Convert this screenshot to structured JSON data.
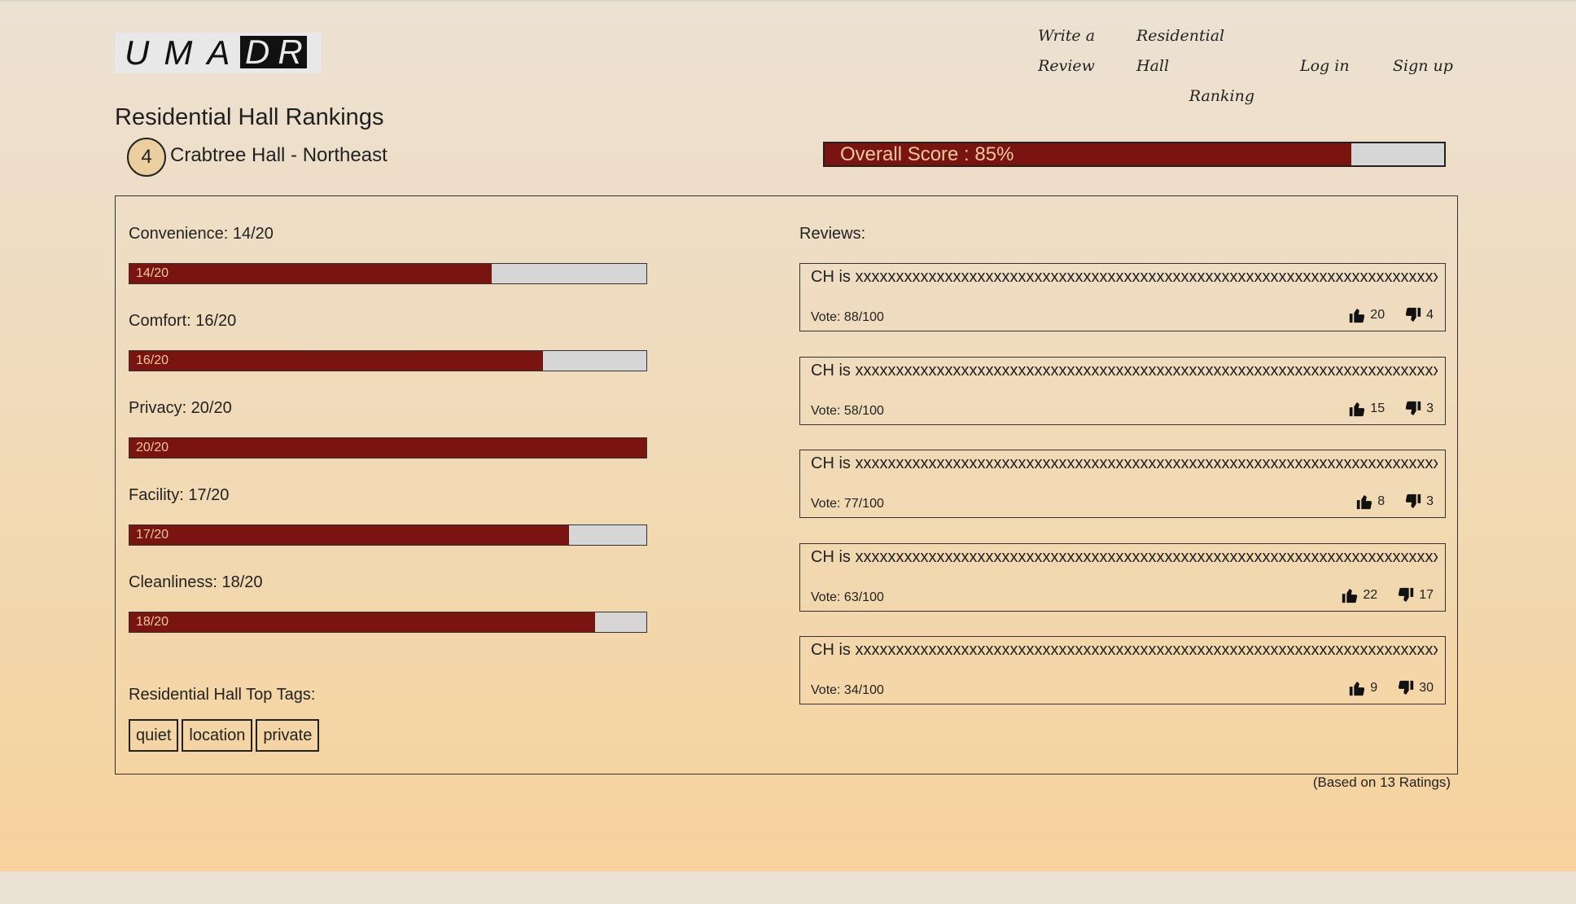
{
  "header": {
    "logo_left": "UMA",
    "logo_right": "DR",
    "nav": {
      "write_line1": "Write a",
      "write_line2": "Review",
      "ranking_line1": "Residential Hall",
      "ranking_line2": "Ranking",
      "login": "Log in",
      "signup": "Sign up"
    }
  },
  "page": {
    "title": "Residential Hall Rankings",
    "rank": "4",
    "hall_name": "Crabtree Hall - Northeast",
    "overall_label": "Overall Score : 85%",
    "overall_percent": 85
  },
  "criteria": [
    {
      "label": "Convenience: 14/20",
      "bar_text": "14/20",
      "score": 14,
      "max": 20
    },
    {
      "label": "Comfort: 16/20",
      "bar_text": "16/20",
      "score": 16,
      "max": 20
    },
    {
      "label": "Privacy: 20/20",
      "bar_text": "20/20",
      "score": 20,
      "max": 20
    },
    {
      "label": "Facility: 17/20",
      "bar_text": "17/20",
      "score": 17,
      "max": 20
    },
    {
      "label": "Cleanliness: 18/20",
      "bar_text": "18/20",
      "score": 18,
      "max": 20
    }
  ],
  "tags": {
    "title": "Residential Hall Top Tags:",
    "items": [
      "quiet",
      "location",
      "private"
    ]
  },
  "reviews": {
    "title": "Reviews:",
    "items": [
      {
        "text": "CH is xxxxxxxxxxxxxxxxxxxxxxxxxxxxxxxxxxxxxxxxxxxxxxxxxxxxxxxxxxxxxxxxxxxxxxxxxxxxxxxxxxxxxx",
        "vote": "Vote: 88/100",
        "up": "20",
        "down": "4"
      },
      {
        "text": "CH is xxxxxxxxxxxxxxxxxxxxxxxxxxxxxxxxxxxxxxxxxxxxxxxxxxxxxxxxxxxxxxxxxxxxxxxxxxxxxxxxxxxxxx",
        "vote": "Vote: 58/100",
        "up": "15",
        "down": "3"
      },
      {
        "text": "CH is xxxxxxxxxxxxxxxxxxxxxxxxxxxxxxxxxxxxxxxxxxxxxxxxxxxxxxxxxxxxxxxxxxxxxxxxxxxxxxxxxxxxxxx",
        "vote": "Vote: 77/100",
        "up": "8",
        "down": "3"
      },
      {
        "text": "CH is xxxxxxxxxxxxxxxxxxxxxxxxxxxxxxxxxxxxxxxxxxxxxxxxxxxxxxxxxxxxxxxxxxxxxxxxxxxxxxxxxxxxxx",
        "vote": "Vote: 63/100",
        "up": "22",
        "down": "17"
      },
      {
        "text": "CH is xxxxxxxxxxxxxxxxxxxxxxxxxxxxxxxxxxxxxxxxxxxxxxxxxxxxxxxxxxxxxxxxxxxxxxxxxxxxxxxxxxxxxx",
        "vote": "Vote: 34/100",
        "up": "9",
        "down": "30"
      }
    ]
  },
  "footnote": "(Based on 13 Ratings)",
  "icons": {
    "thumb_up": "thumbs-up-icon",
    "thumb_down": "thumbs-down-icon"
  },
  "colors": {
    "bar_fill": "#7a1410",
    "bar_track": "#d6d6d6",
    "bar_text": "#f2c9a0",
    "badge": "#eccf9e"
  }
}
